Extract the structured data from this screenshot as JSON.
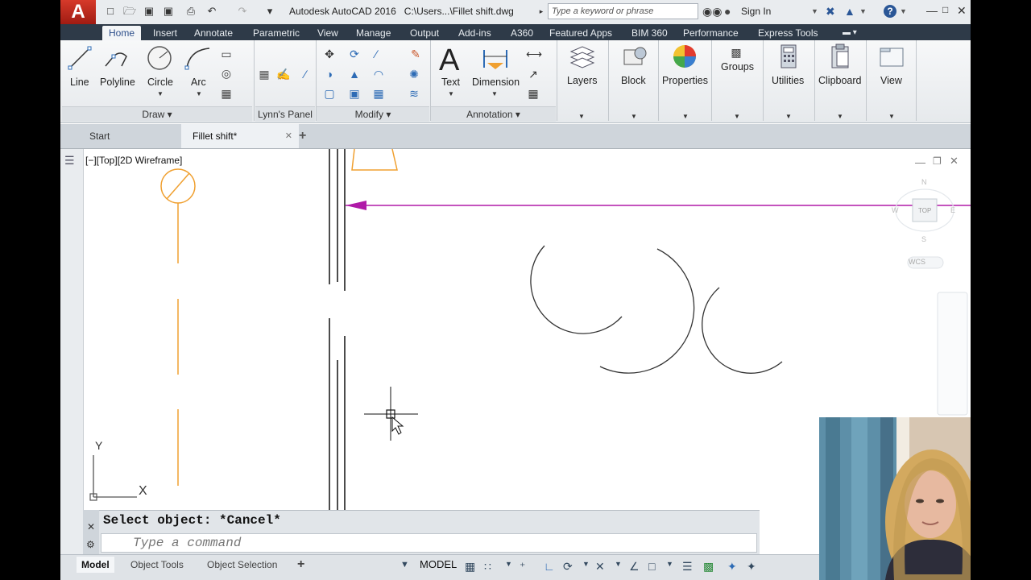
{
  "titlebar": {
    "app_title": "Autodesk AutoCAD 2016",
    "file_path": "C:\\Users...\\Fillet shift.dwg",
    "search_placeholder": "Type a keyword or phrase",
    "sign_in": "Sign In",
    "app_logo": "A"
  },
  "ribbon_tabs": [
    "Home",
    "Insert",
    "Annotate",
    "Parametric",
    "View",
    "Manage",
    "Output",
    "Add-ins",
    "A360",
    "Featured Apps",
    "BIM 360",
    "Performance",
    "Express Tools"
  ],
  "ribbon": {
    "draw": {
      "line": "Line",
      "polyline": "Polyline",
      "circle": "Circle",
      "arc": "Arc",
      "panel": "Draw"
    },
    "lynns_panel": "Lynn's Panel",
    "modify_panel": "Modify",
    "annotation": {
      "text": "Text",
      "dimension": "Dimension",
      "panel": "Annotation"
    },
    "layers": "Layers",
    "block": "Block",
    "properties": "Properties",
    "groups": "Groups",
    "utilities": "Utilities",
    "clipboard": "Clipboard",
    "view": "View"
  },
  "doc_tabs": {
    "start": "Start",
    "active": "Fillet shift*"
  },
  "viewport": {
    "label": "[−][Top][2D Wireframe]",
    "viewcube_top": "TOP",
    "wcs": "WCS",
    "ucs_y": "Y",
    "ucs_x": "X",
    "viewcube_n": "N",
    "viewcube_s": "S",
    "viewcube_w": "W",
    "viewcube_e": "E"
  },
  "command": {
    "history": "Select object: *Cancel*",
    "placeholder": "Type a command"
  },
  "status": {
    "model_tab": "Model",
    "layout_tabs": [
      "Object Tools",
      "Object Selection"
    ],
    "model_space": "MODEL"
  },
  "colors": {
    "orange_entity": "#f0a030",
    "magenta_entity": "#b01aa8",
    "ribbon_tab_bg": "#2e3a48"
  }
}
